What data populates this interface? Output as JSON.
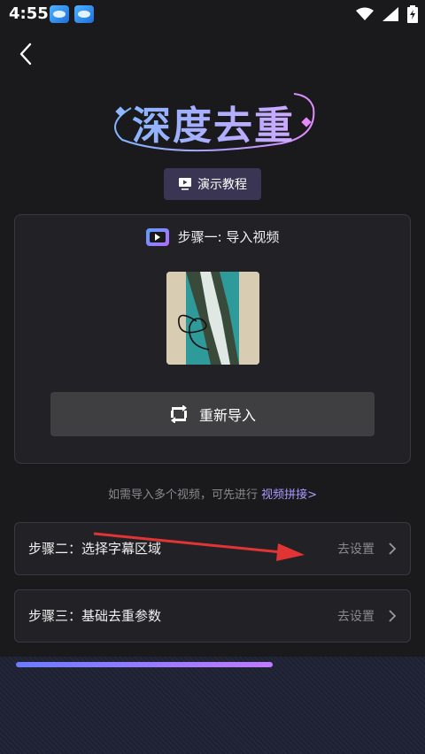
{
  "statusbar": {
    "time": "4:55",
    "icons": [
      "app-notif-icon",
      "app-notif-icon",
      "wifi-icon",
      "signal-icon",
      "battery-icon"
    ]
  },
  "header": {
    "back_icon": "chevron-left-icon",
    "title": "深度去重"
  },
  "demo_button": {
    "label": "演示教程",
    "icon": "play-screen-icon"
  },
  "step1": {
    "title": "步骤一: 导入视频",
    "reimport_label": "重新导入"
  },
  "hint": {
    "text": "如需导入多个视频，可先进行",
    "link": "视频拼接>"
  },
  "steps": [
    {
      "label": "步骤二：选择字幕区域",
      "action": "去设置"
    },
    {
      "label": "步骤三：基础去重参数",
      "action": "去设置"
    }
  ],
  "colors": {
    "background": "#1a1a1c",
    "accent": "#a99cff",
    "card": "#222226"
  }
}
